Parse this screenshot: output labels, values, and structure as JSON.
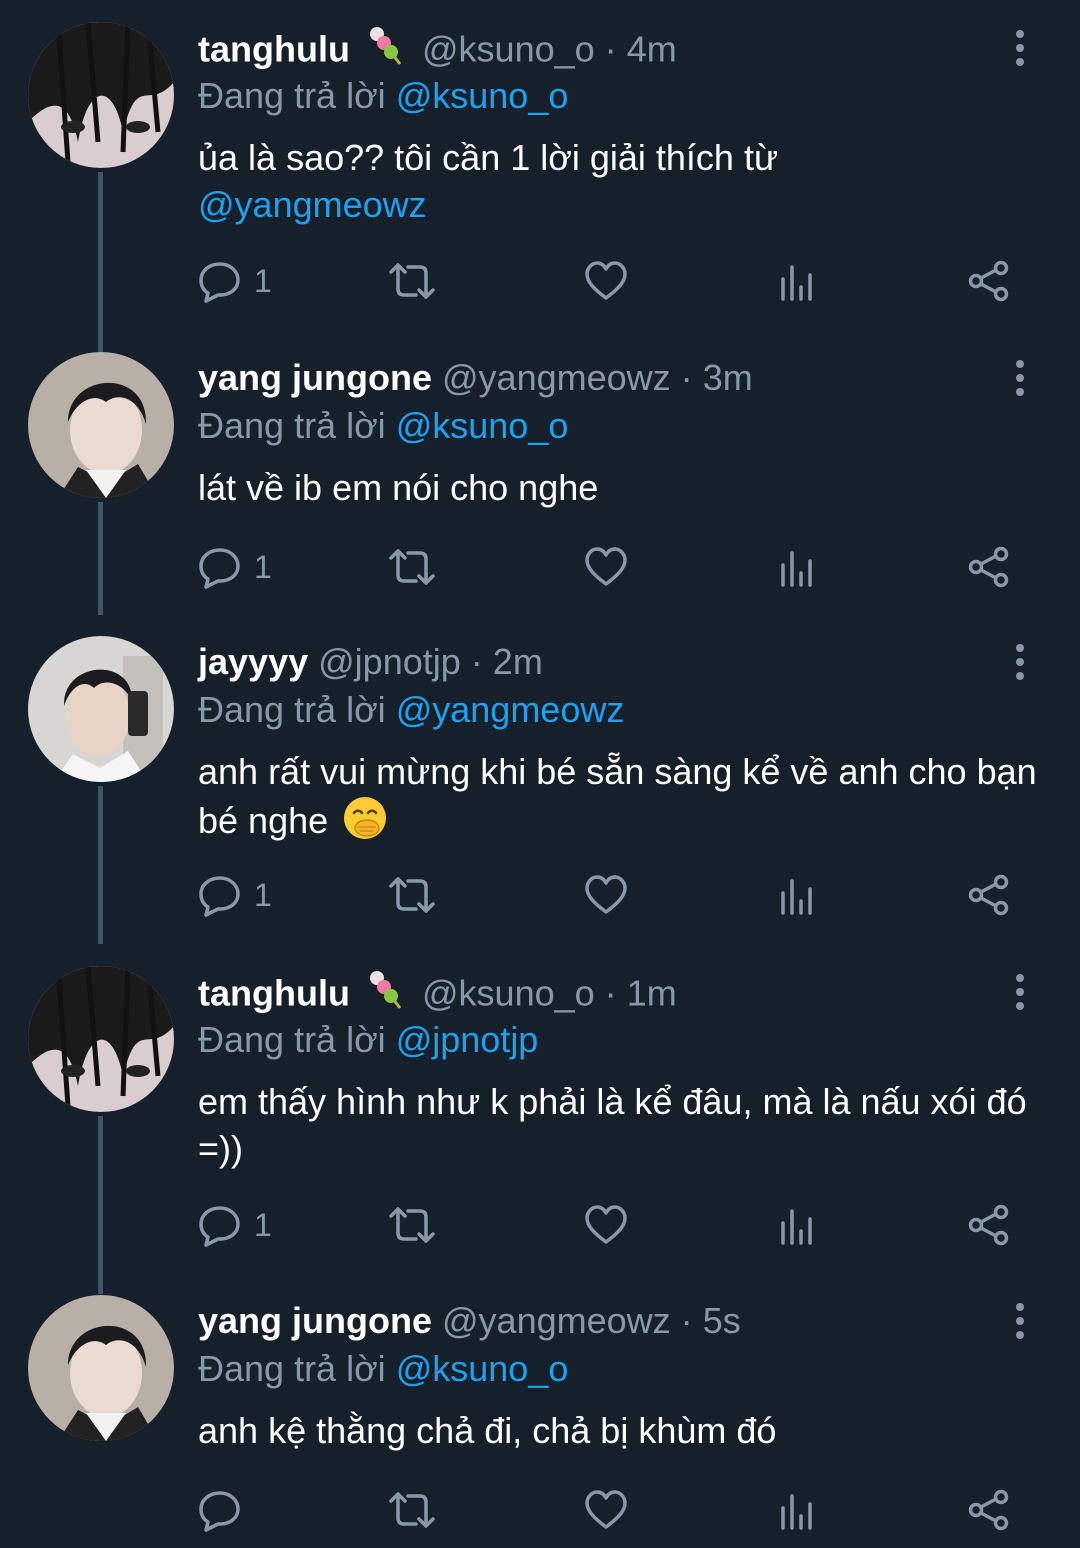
{
  "replying_prefix": "Đang trả lời",
  "tweets": [
    {
      "name": "tanghulu",
      "name_emoji": "tanghulu-emoji",
      "handle": "@ksuno_o",
      "time": "4m",
      "replying_to": "@ksuno_o",
      "text": "ủa là sao?? tôi cần 1 lời giải thích từ",
      "text_mention": "@yangmeowz",
      "reply_count": "1"
    },
    {
      "name": "yang jungone",
      "handle": "@yangmeowz",
      "time": "3m",
      "replying_to": "@ksuno_o",
      "text": "lát về ib em nói cho nghe",
      "reply_count": "1"
    },
    {
      "name": "jayyyy",
      "handle": "@jpnotjp",
      "time": "2m",
      "replying_to": "@yangmeowz",
      "text": "anh rất vui mừng khi bé sẵn sàng kể về anh cho bạn bé nghe",
      "text_emoji": "hand-over-mouth-emoji",
      "reply_count": "1"
    },
    {
      "name": "tanghulu",
      "name_emoji": "tanghulu-emoji",
      "handle": "@ksuno_o",
      "time": "1m",
      "replying_to": "@jpnotjp",
      "text": "em thấy hình như k phải là kể đâu, mà là nấu xói đó =))",
      "reply_count": "1"
    },
    {
      "name": "yang jungone",
      "handle": "@yangmeowz",
      "time": "5s",
      "replying_to": "@ksuno_o",
      "text": "anh kệ thằng chả đi, chả bị khùm đó",
      "reply_count": ""
    }
  ],
  "colors": {
    "background": "#15202b",
    "text": "#ffffff",
    "secondary": "#8899a6",
    "accent": "#1da1f2",
    "thread_line": "#3d5466"
  },
  "icons": [
    "reply-icon",
    "retweet-icon",
    "like-icon",
    "analytics-icon",
    "share-icon",
    "more-icon"
  ]
}
